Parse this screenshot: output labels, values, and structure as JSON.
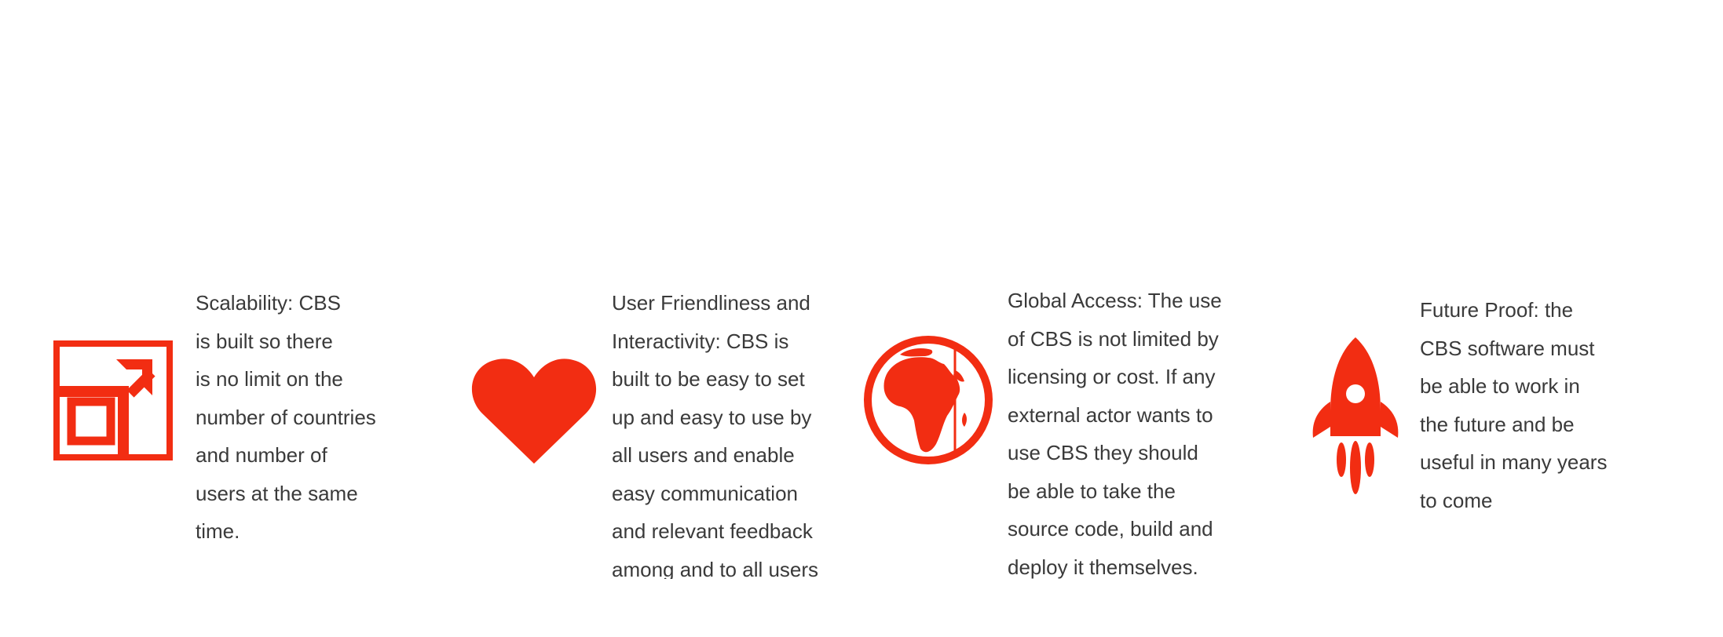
{
  "accent_color": "#f22d12",
  "text_color": "#3a3a3a",
  "features": [
    {
      "icon": "expand-arrow-icon",
      "text": "Scalability: CBS\nis built so there\nis no limit on the\nnumber of countries\nand number of\nusers at the same\ntime."
    },
    {
      "icon": "heart-icon",
      "text": "User Friendliness and\nInteractivity: CBS is\nbuilt to be easy to set\nup and easy to use by\nall users and enable\neasy communication\nand relevant feedback\namong and to all users"
    },
    {
      "icon": "globe-africa-icon",
      "text": "Global Access: The use\nof CBS is not limited by\nlicensing or cost. If any\nexternal actor wants to\nuse CBS they should\nbe able to take the\nsource code, build and\ndeploy it themselves."
    },
    {
      "icon": "rocket-icon",
      "text": "Future Proof: the\nCBS software must\nbe able to work in\nthe future and be\nuseful in many years\nto come"
    }
  ]
}
